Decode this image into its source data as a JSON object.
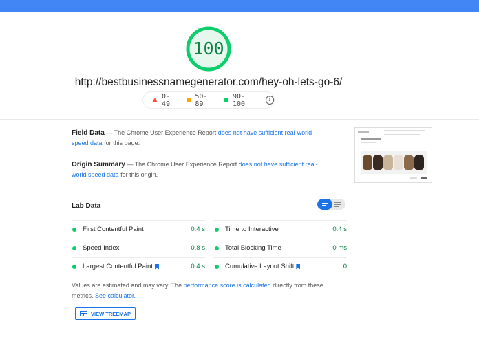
{
  "score": {
    "value": "100",
    "color": "#0cce6b"
  },
  "url": "http://bestbusinessnamegenerator.com/hey-oh-lets-go-6/",
  "legend": {
    "fail": "0-49",
    "average": "50-89",
    "pass": "90-100",
    "info_icon": "info-icon"
  },
  "field_data": {
    "heading": "Field Data",
    "prefix": "— The Chrome User Experience Report",
    "link": "does not have sufficient real-world speed data",
    "suffix": "for this page."
  },
  "origin_summary": {
    "heading": "Origin Summary",
    "prefix": "— The Chrome User Experience Report",
    "link": "does not have sufficient real-world speed data",
    "suffix": "for this origin."
  },
  "lab_data": {
    "title": "Lab Data",
    "metrics": [
      {
        "name": "First Contentful Paint",
        "value": "0.4 s",
        "flag": false
      },
      {
        "name": "Time to Interactive",
        "value": "0.4 s",
        "flag": false
      },
      {
        "name": "Speed Index",
        "value": "0.8 s",
        "flag": false
      },
      {
        "name": "Total Blocking Time",
        "value": "0 ms",
        "flag": false
      },
      {
        "name": "Largest Contentful Paint",
        "value": "0.4 s",
        "flag": true
      },
      {
        "name": "Cumulative Layout Shift",
        "value": "0",
        "flag": true
      }
    ]
  },
  "note": {
    "text1": "Values are estimated and may vary. The",
    "link1": "performance score is calculated",
    "text2": "directly from these metrics.",
    "link2": "See calculator."
  },
  "treemap_button": "VIEW TREEMAP",
  "colors": {
    "accent": "#1a73e8",
    "pass": "#0cce6b",
    "pass_text": "#0b8043",
    "average": "#ffa400",
    "fail": "#ff4e42",
    "top_bar": "#4285f4"
  }
}
